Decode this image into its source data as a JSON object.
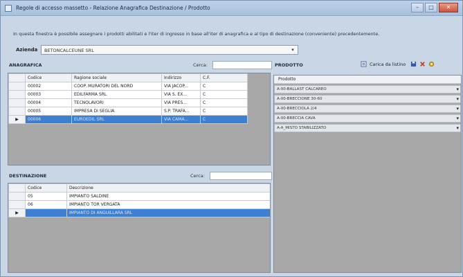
{
  "window": {
    "title": "Regole di accesso massetto - Relazione Anagrafica Destinazione / Prodotto",
    "buttons": {
      "minimize": "–",
      "maximize": "□",
      "close": "✕"
    }
  },
  "info_text": "In questa finestra è possibile assegnare i prodotti abilitati e l'iter di ingresso in base all'iter di anagrafica e al tipo di destinazione (conveniente) precedentemente.",
  "azienda": {
    "label": "Azienda",
    "value": "BETONCALCEUNE SRL"
  },
  "anagrafica": {
    "label": "ANAGRAFICA",
    "cerca_label": "Cerca:",
    "columns": [
      "Codice",
      "Ragione sociale",
      "Indirizzo",
      "C.F."
    ],
    "rows": [
      {
        "codice": "00002",
        "ragione": "COOP. MURATORI DEL NORD",
        "indirizzo": "VIA JACOP...",
        "cf": "C",
        "selected": false
      },
      {
        "codice": "00003",
        "ragione": "EDILFARMA SRL",
        "indirizzo": "VIA S. EX...",
        "cf": "C",
        "selected": false
      },
      {
        "codice": "00004",
        "ragione": "TECNOLAVORI",
        "indirizzo": "VIA PRES...",
        "cf": "C",
        "selected": false
      },
      {
        "codice": "00005",
        "ragione": "IMPRESA DI SEGLIA",
        "indirizzo": "S.P. TRAFA...",
        "cf": "C",
        "selected": false
      },
      {
        "codice": "00006",
        "ragione": "EUROEDIL SRL",
        "indirizzo": "VIA CAMA...",
        "cf": "C",
        "selected": true
      }
    ]
  },
  "destinazione": {
    "label": "DESTINAZIONE",
    "cerca_label": "Cerca:",
    "columns": [
      "Codice",
      "Descrizione"
    ],
    "rows": [
      {
        "codice": "05",
        "descrizione": "IMPIANTO SALDINE",
        "selected": false
      },
      {
        "codice": "06",
        "descrizione": "IMPIANTO TOR VERGATA",
        "selected": false
      },
      {
        "codice": "",
        "descrizione": "IMPIANTO DI ANGUILLARA SRL",
        "selected": true
      }
    ]
  },
  "prodotto": {
    "label": "PRODOTTO",
    "toolbar": {
      "load_label": "Carica da listino"
    },
    "column": "Prodotto",
    "rows": [
      "A-00-BALLAST CALCAREO",
      "A-00-BRECCIONE 30-60",
      "A-00-BRECCIOLA 2/4",
      "A-00-BRECCIA CAVA",
      "A-A_MISTO STABILIZZATO"
    ]
  },
  "colors": {
    "selection": "#3d7fd1",
    "window_bg": "#c9d6e6",
    "grid_empty": "#a8a8a8"
  }
}
